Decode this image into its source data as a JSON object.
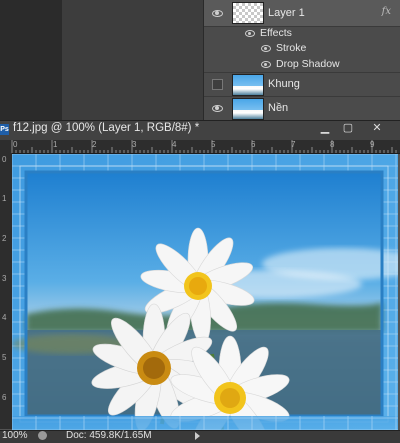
{
  "layers_panel": {
    "layers": [
      {
        "name": "Layer 1",
        "visible": true,
        "thumbnail": "transparent",
        "fx": "fx"
      },
      {
        "name": "Khung",
        "visible": false,
        "thumbnail": "photo"
      },
      {
        "name": "Nền",
        "visible": true,
        "thumbnail": "photo"
      }
    ],
    "effects": {
      "label": "Effects",
      "items": [
        "Stroke",
        "Drop Shadow"
      ]
    }
  },
  "document": {
    "badge": "Ps",
    "title": "f12.jpg @ 100% (Layer 1, RGB/8#) *",
    "window_buttons": {
      "minimize": "▁",
      "restore": "▢",
      "close": "✕"
    },
    "ruler_top_labels": [
      "0",
      "1",
      "2",
      "3",
      "4",
      "5",
      "6",
      "7",
      "8",
      "9"
    ],
    "ruler_left_labels": [
      "0",
      "1",
      "2",
      "3",
      "4",
      "5",
      "6",
      "7"
    ]
  },
  "status_bar": {
    "zoom": "100%",
    "doc_info": "Doc: 459.8K/1.65M"
  },
  "colors": {
    "sky": "#2f8fd8",
    "frame_blue": "#4aa0dc",
    "petal": "#f5f5f5",
    "flower_center": "#f2c41c"
  }
}
